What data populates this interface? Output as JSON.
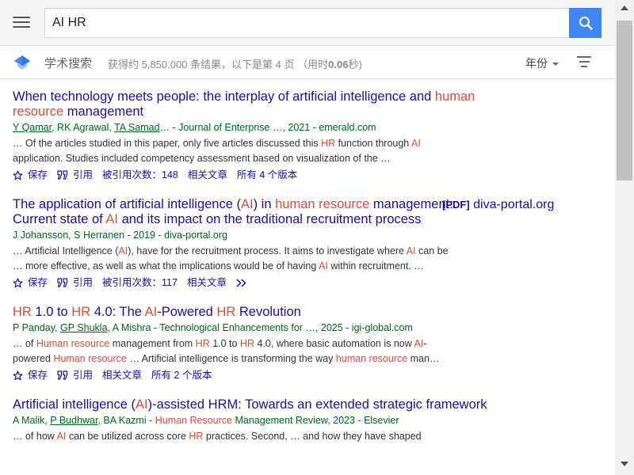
{
  "search": {
    "query": "AI HR"
  },
  "header": {
    "brand": "学术搜索",
    "stats_prefix": "获得约 5,850,000 条结果，以下是第 4 页 （用时",
    "stats_time": "0.06",
    "stats_suffix": "秒)",
    "year_filter": "年份"
  },
  "icons": {
    "menu": "hamburger-menu-icon",
    "search": "magnifier-icon",
    "logo": "scholar-cap-icon",
    "filter": "filter-lines-icon",
    "save": "star-outline-icon",
    "cite": "quote-icon",
    "more": "double-chevron-right-icon"
  },
  "colors": {
    "accent_blue": "#4285f4",
    "link": "#1a0dab",
    "highlight": "#dd4b39",
    "source_green": "#006621"
  },
  "results": [
    {
      "title_parts": [
        {
          "t": "When technology meets people: the interplay of artificial intelligence and ",
          "h": false
        },
        {
          "t": "human resource",
          "h": true
        },
        {
          "t": " management",
          "h": false
        }
      ],
      "pdf": null,
      "meta_parts": [
        {
          "t": "Y Qamar",
          "link": true
        },
        {
          "t": ", RK Agrawal, ",
          "link": false
        },
        {
          "t": "TA Samad",
          "link": true
        },
        {
          "t": "… - Journal of Enterprise …, 2021 - emerald.com",
          "link": false
        }
      ],
      "snippet_parts": [
        {
          "t": "… Of the articles studied in this paper, only five articles discussed this ",
          "h": false
        },
        {
          "t": "HR",
          "h": true
        },
        {
          "t": " function through ",
          "h": false
        },
        {
          "t": "AI",
          "h": true
        },
        {
          "t": " application. Studies included competency assessment based on visualization of the …",
          "h": false
        }
      ],
      "actions": [
        {
          "label": "保存",
          "icon": "save"
        },
        {
          "label": "引用",
          "icon": "cite"
        },
        {
          "label": "被引用次数：148",
          "icon": null
        },
        {
          "label": "相关文章",
          "icon": null
        },
        {
          "label": "所有 4 个版本",
          "icon": null
        }
      ]
    },
    {
      "title_parts": [
        {
          "t": "The application of artificial intelligence (",
          "h": false
        },
        {
          "t": "AI",
          "h": true
        },
        {
          "t": ") in ",
          "h": false
        },
        {
          "t": "human resource",
          "h": true
        },
        {
          "t": " management: Current state of ",
          "h": false
        },
        {
          "t": "AI",
          "h": true
        },
        {
          "t": " and its impact on the traditional recruitment process",
          "h": false
        }
      ],
      "pdf": {
        "tag": "[PDF]",
        "site": "diva-portal.org"
      },
      "meta_parts": [
        {
          "t": "J Johansson, S Herranen - 2019 - diva-portal.org",
          "link": false
        }
      ],
      "snippet_parts": [
        {
          "t": "… Artificial Intelligence (",
          "h": false
        },
        {
          "t": "AI",
          "h": true
        },
        {
          "t": "), have for the recruitment process. It aims to investigate where ",
          "h": false
        },
        {
          "t": "AI",
          "h": true
        },
        {
          "t": " can be … more effective, as well as what the implications would be of having ",
          "h": false
        },
        {
          "t": "AI",
          "h": true
        },
        {
          "t": " within recruitment. …",
          "h": false
        }
      ],
      "actions": [
        {
          "label": "保存",
          "icon": "save"
        },
        {
          "label": "引用",
          "icon": "cite"
        },
        {
          "label": "被引用次数：117",
          "icon": null
        },
        {
          "label": "相关文章",
          "icon": null
        },
        {
          "label": "",
          "icon": "more"
        }
      ]
    },
    {
      "title_parts": [
        {
          "t": "HR",
          "h": true
        },
        {
          "t": " 1.0 to ",
          "h": false
        },
        {
          "t": "HR",
          "h": true
        },
        {
          "t": " 4.0: The ",
          "h": false
        },
        {
          "t": "AI",
          "h": true
        },
        {
          "t": "-Powered ",
          "h": false
        },
        {
          "t": "HR",
          "h": true
        },
        {
          "t": " Revolution",
          "h": false
        }
      ],
      "pdf": null,
      "meta_parts": [
        {
          "t": "P Panday, ",
          "link": false
        },
        {
          "t": "GP Shukla",
          "link": true
        },
        {
          "t": ", A Mishra - Technological Enhancements for …, 2025 - igi-global.com",
          "link": false
        }
      ],
      "snippet_parts": [
        {
          "t": "… of ",
          "h": false
        },
        {
          "t": "Human resource",
          "h": true
        },
        {
          "t": " management from ",
          "h": false
        },
        {
          "t": "HR",
          "h": true
        },
        {
          "t": " 1.0 to ",
          "h": false
        },
        {
          "t": "HR",
          "h": true
        },
        {
          "t": " 4.0, where basic automation is now ",
          "h": false
        },
        {
          "t": "AI",
          "h": true
        },
        {
          "t": "-powered ",
          "h": false
        },
        {
          "t": "Human resource",
          "h": true
        },
        {
          "t": " … Artificial intelligence is transforming the way ",
          "h": false
        },
        {
          "t": "human resource",
          "h": true
        },
        {
          "t": " man…",
          "h": false
        }
      ],
      "actions": [
        {
          "label": "保存",
          "icon": "save"
        },
        {
          "label": "引用",
          "icon": "cite"
        },
        {
          "label": "相关文章",
          "icon": null
        },
        {
          "label": "所有 2 个版本",
          "icon": null
        }
      ]
    },
    {
      "title_parts": [
        {
          "t": "Artificial intelligence (",
          "h": false
        },
        {
          "t": "AI",
          "h": true
        },
        {
          "t": ")-assisted HRM: Towards an extended strategic framework",
          "h": false
        }
      ],
      "pdf": null,
      "meta_parts": [
        {
          "t": "A Malik, ",
          "link": false
        },
        {
          "t": "P Budhwar",
          "link": true
        },
        {
          "t": ", BA Kazmi - ",
          "link": false
        },
        {
          "t": "Human Resource",
          "link": false,
          "red": true
        },
        {
          "t": " Management Review, 2023 - Elsevier",
          "link": false
        }
      ],
      "snippet_parts": [
        {
          "t": "… of how ",
          "h": false
        },
        {
          "t": "AI",
          "h": true
        },
        {
          "t": " can be utilized across core ",
          "h": false
        },
        {
          "t": "HR",
          "h": true
        },
        {
          "t": " practices. Second, … and how they have shaped",
          "h": false
        }
      ],
      "actions": []
    }
  ]
}
